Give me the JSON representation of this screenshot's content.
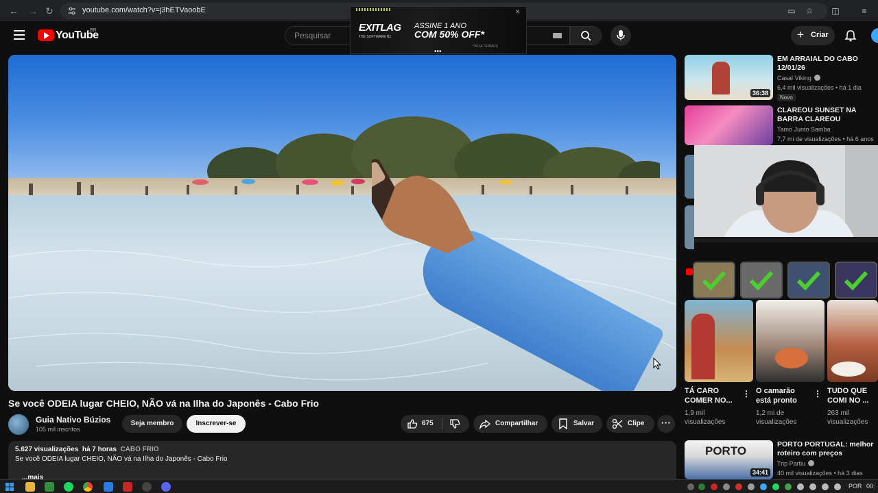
{
  "browser": {
    "url": "youtube.com/watch?v=j3hETVaoobE"
  },
  "header": {
    "logo_text": "YouTube",
    "country_code": "BR",
    "search_placeholder": "Pesquisar",
    "create_label": "Criar"
  },
  "ad": {
    "brand": "EXITLAG",
    "brand_sub": "THE SOFTWARE N1",
    "line1": "ASSINE 1 ANO",
    "line2": "COM 50% OFF*",
    "terms": "*VEJA TERMOS"
  },
  "video": {
    "title": "Se você ODEIA lugar CHEIO, NÃO vá na Ilha do Japonês - Cabo Frio",
    "channel_name": "Guia Nativo Búzios",
    "channel_subs": "105 mil inscritos",
    "member_label": "Seja membro",
    "subscribe_label": "Inscrever-se",
    "like_count": "675",
    "share_label": "Compartilhar",
    "save_label": "Salvar",
    "clip_label": "Clipe"
  },
  "description": {
    "views": "5.627 visualizações",
    "age": "há 7 horas",
    "tag": "CABO FRIO",
    "text": "Se você ODEIA lugar CHEIO, NÃO vá na Ilha do Japonês - Cabo Frio",
    "more": "...mais"
  },
  "recommendations": [
    {
      "title": "EM ARRAIAL DO CABO 12/01/26",
      "channel": "Casal Viking",
      "meta": "6,4 mil visualizações • há 1 dia",
      "badge": "Novo",
      "duration": "36:38",
      "thumb_color": "#7fc6da"
    },
    {
      "title": "CLAREOU SUNSET NA BARRA CLAREOU",
      "channel": "Tamo Junto Samba",
      "meta": "7,7 mi de visualizações • há 6 anos",
      "thumb_color": "#d4529e"
    },
    {
      "title": "PORTO PORTUGAL: melhor roteiro com preços",
      "channel": "Trip Partiu",
      "meta": "40 mil visualizações • há 3 dias",
      "duration": "34:41",
      "thumb_color": "#4b6fa8",
      "thumb_text": "PORTO"
    }
  ],
  "shorts": [
    {
      "title": "TÁ CARO COMER NO...",
      "views": "1,9 mil visualizações",
      "thumb_color": "#c58b50"
    },
    {
      "title": "O camarão está pronto",
      "views": "1,2 mi de visualizações",
      "thumb_color": "#a1897a"
    },
    {
      "title": "TUDO QUE COMI NO ...",
      "views": "263 mil visualizações",
      "thumb_color": "#b65e3f"
    }
  ],
  "taskbar": {
    "language": "POR",
    "clock": "00:"
  },
  "colors": {
    "yt_red": "#ff0000",
    "background": "#0f0f0f",
    "pill": "#272727",
    "sleeve": "#4a8ad8",
    "check_green": "#4ccf2e"
  }
}
